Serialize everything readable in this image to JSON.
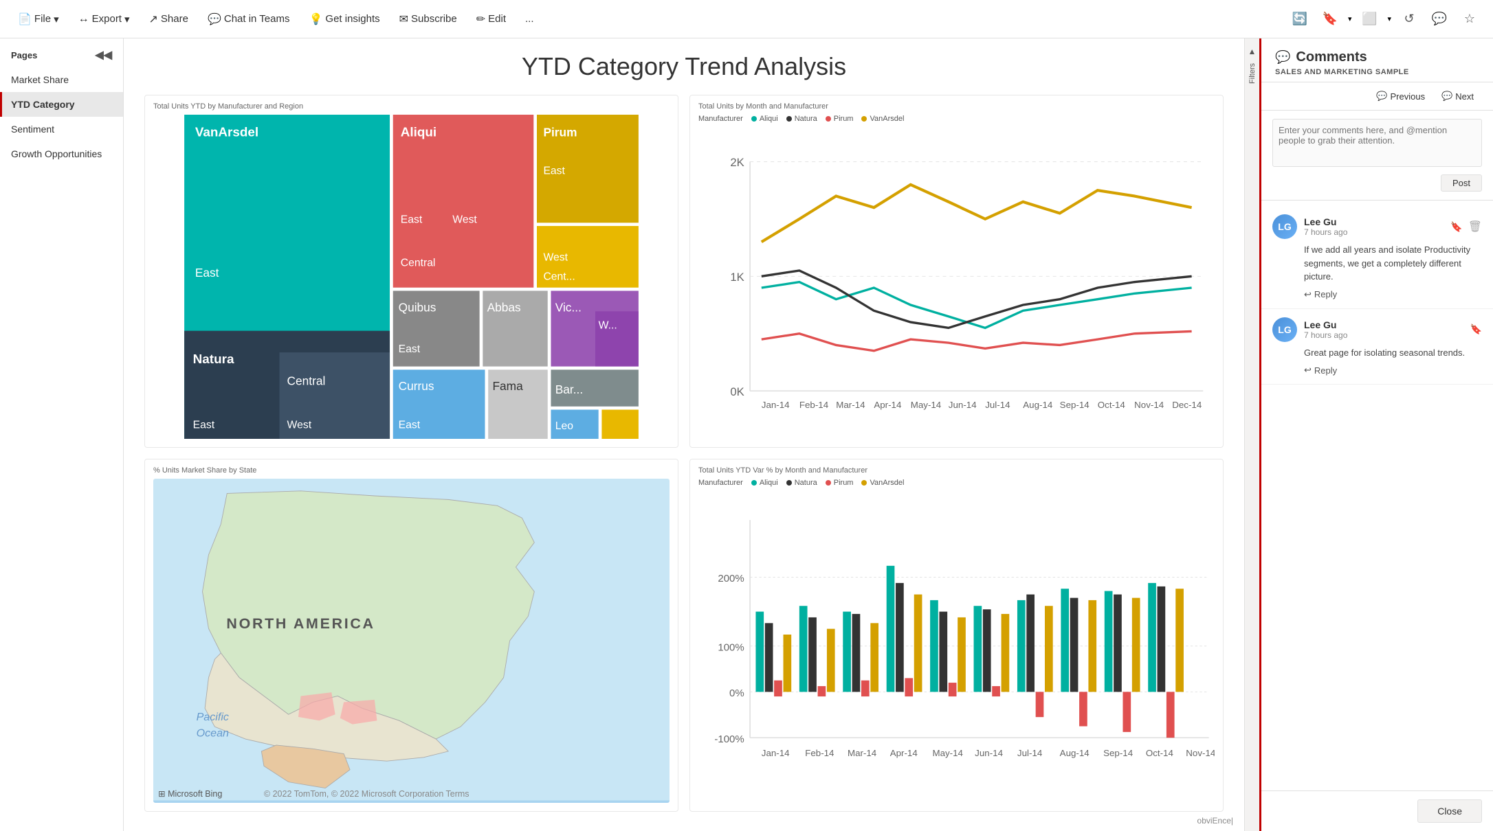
{
  "toolbar": {
    "file_label": "File",
    "export_label": "Export",
    "share_label": "Share",
    "chat_teams_label": "Chat in Teams",
    "get_insights_label": "Get insights",
    "subscribe_label": "Subscribe",
    "edit_label": "Edit",
    "more_label": "..."
  },
  "sidebar": {
    "title": "Pages",
    "items": [
      {
        "label": "Market Share",
        "active": false
      },
      {
        "label": "YTD Category",
        "active": true
      },
      {
        "label": "Sentiment",
        "active": false
      },
      {
        "label": "Growth Opportunities",
        "active": false
      }
    ]
  },
  "main": {
    "page_title": "YTD Category Trend Analysis",
    "charts": [
      {
        "id": "treemap",
        "title": "Total Units YTD by Manufacturer and Region"
      },
      {
        "id": "linechart",
        "title": "Total Units by Month and Manufacturer",
        "legend": [
          "Aliqui",
          "Natura",
          "Pirum",
          "VanArsdel"
        ],
        "legend_colors": [
          "#00b0a0",
          "#333",
          "#e05050",
          "#d4a000"
        ]
      },
      {
        "id": "map",
        "title": "% Units Market Share by State",
        "map_label": "NORTH AMERICA",
        "ocean_label": "Pacific Ocean"
      },
      {
        "id": "barchart",
        "title": "Total Units YTD Var % by Month and Manufacturer",
        "legend": [
          "Aliqui",
          "Natura",
          "Pirum",
          "VanArsdel"
        ],
        "legend_colors": [
          "#00b0a0",
          "#333",
          "#e05050",
          "#d4a000"
        ]
      }
    ]
  },
  "filters": {
    "label": "Filters"
  },
  "comments": {
    "title": "Comments",
    "subtitle": "SALES AND MARKETING SAMPLE",
    "nav": {
      "previous_label": "Previous",
      "next_label": "Next"
    },
    "input_placeholder": "Enter your comments here, and @mention people to grab their attention.",
    "post_label": "Post",
    "items": [
      {
        "id": 1,
        "author": "Lee Gu",
        "time": "7 hours ago",
        "text": "If we add all years and isolate Productivity segments, we get a completely different picture.",
        "reply_label": "Reply"
      },
      {
        "id": 2,
        "author": "Lee Gu",
        "time": "7 hours ago",
        "text": "Great page for isolating seasonal trends.",
        "reply_label": "Reply"
      }
    ],
    "close_label": "Close"
  }
}
